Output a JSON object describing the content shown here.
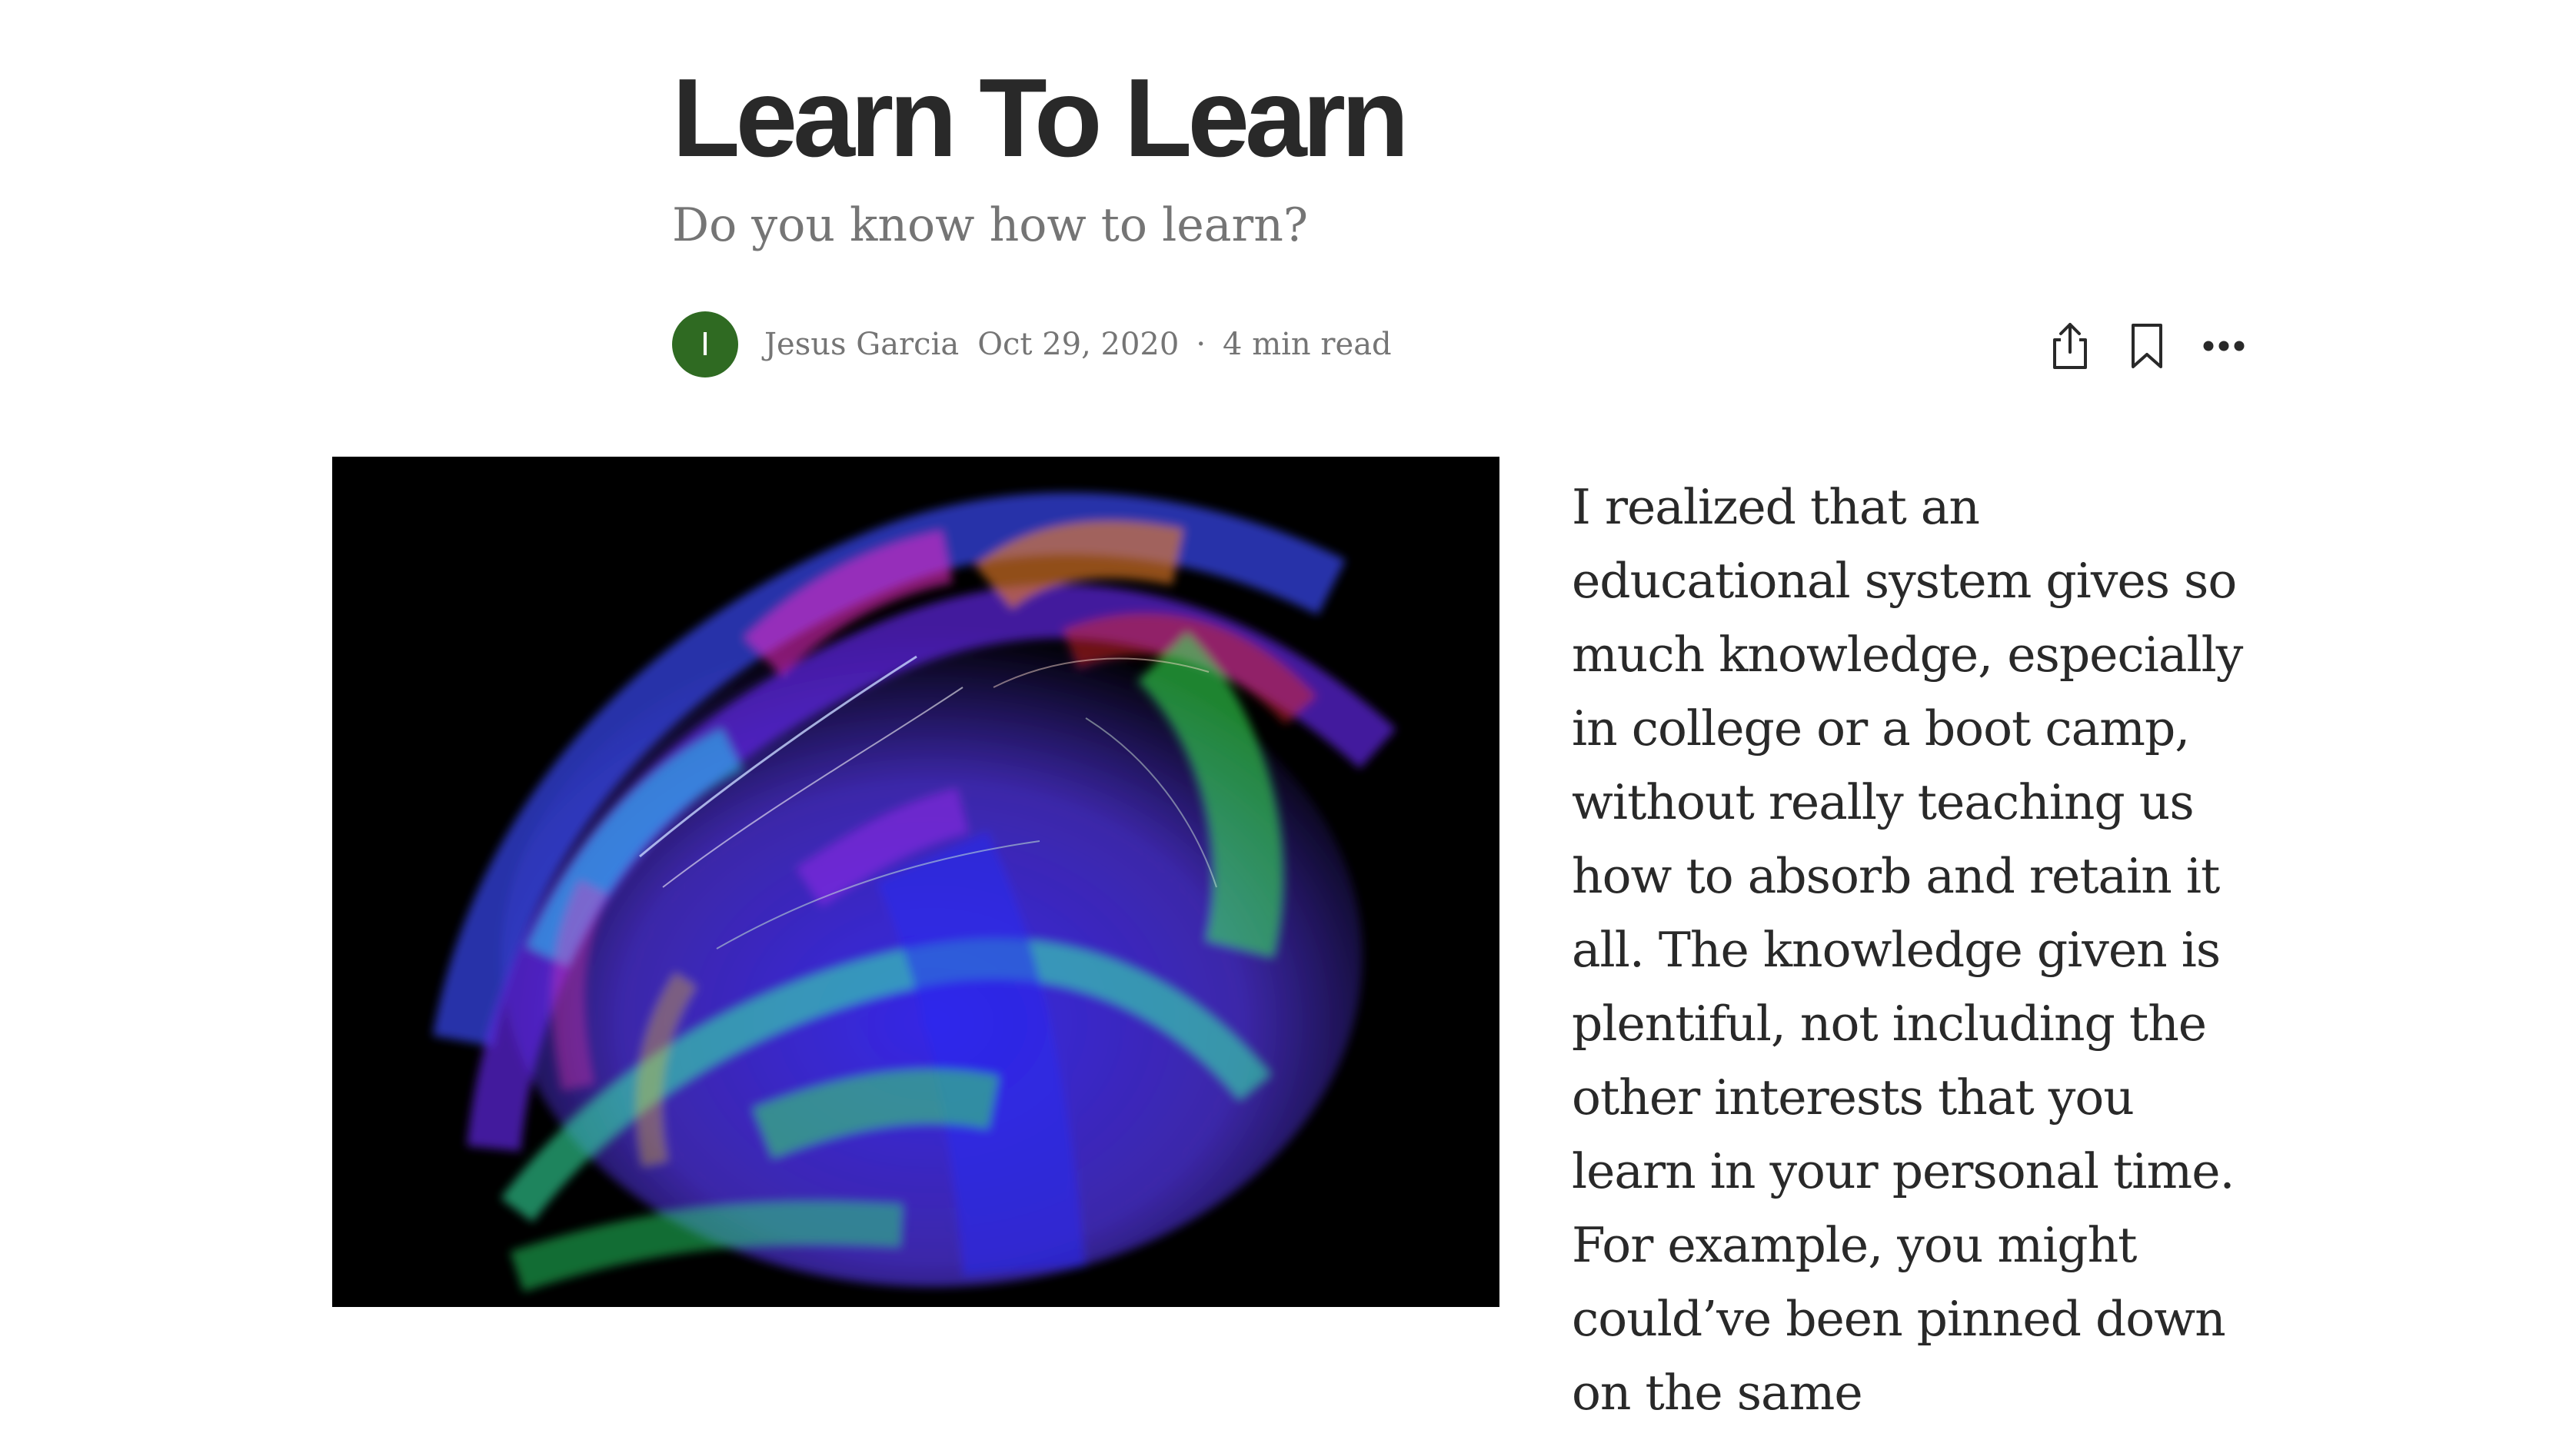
{
  "article": {
    "title": "Learn To Learn",
    "subtitle": "Do you know how to learn?",
    "author": {
      "initial": "I",
      "name": "Jesus Garcia",
      "avatar_color": "#2f6a22"
    },
    "date": "Oct 29, 2020",
    "separator": "·",
    "read_time": "4 min read",
    "actions": [
      {
        "icon": "share-icon"
      },
      {
        "icon": "bookmark-icon"
      },
      {
        "icon": "more-icon"
      }
    ],
    "hero_image": {
      "description_icon": "brain-fiber-tract-image",
      "background": "#000000"
    },
    "body": "I realized that an educational system gives so much knowledge, especially in college or a boot camp, without really teaching us how to absorb and retain it all. The knowledge given is plentiful, not including the other interests that you learn in your personal time. For example, you might could’ve been pinned down on the same"
  },
  "colors": {
    "text": "#292929",
    "muted": "#757575",
    "background": "#ffffff"
  }
}
